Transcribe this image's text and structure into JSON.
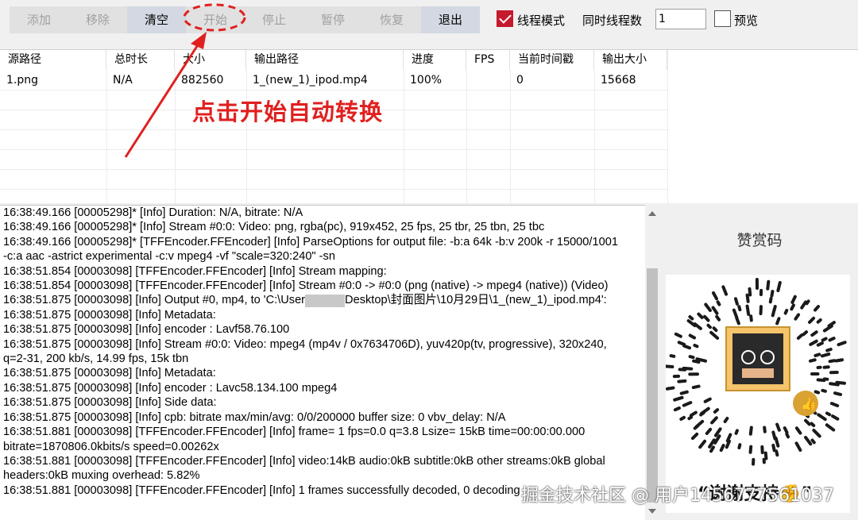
{
  "toolbar": {
    "add": "添加",
    "remove": "移除",
    "clear": "清空",
    "start": "开始",
    "stop": "停止",
    "pause": "暂停",
    "resume": "恢复",
    "exit": "退出",
    "thread_mode_label": "线程模式",
    "concurrent_label": "同时线程数",
    "concurrent_value": "1",
    "preview_label": "预览"
  },
  "table": {
    "headers": [
      "源路径",
      "总时长",
      "大小",
      "输出路径",
      "进度",
      "FPS",
      "当前时间戳",
      "输出大小"
    ],
    "rows": [
      [
        "1.png",
        "N/A",
        "882560",
        "1_(new_1)_ipod.mp4",
        "100%",
        "",
        "0",
        "15668"
      ]
    ]
  },
  "annotation": {
    "text": "点击开始自动转换"
  },
  "log": [
    "16:38:49.166 [00005298]* [Info]   Duration: N/A, bitrate: N/A",
    "16:38:49.166 [00005298]* [Info]   Stream #0:0: Video: png, rgba(pc), 919x452, 25 fps, 25 tbr, 25 tbn, 25 tbc",
    "16:38:49.166 [00005298]* [TFFEncoder.FFEncoder] [Info] ParseOptions for output file: -b:a 64k -b:v 200k -r 15000/1001",
    "-c:a aac -astrict experimental -c:v mpeg4 -vf \"scale=320:240\" -sn",
    "16:38:51.854 [00003098] [TFFEncoder.FFEncoder] [Info] Stream mapping:",
    "16:38:51.854 [00003098] [TFFEncoder.FFEncoder] [Info]   Stream #0:0 -> #0:0 (png (native) -> mpeg4 (native)) (Video)",
    "16:38:51.875 [00003098] [Info] Output #0, mp4, to 'C:\\User",
    "16:38:51.875 [00003098] [Info]   Metadata:",
    "16:38:51.875 [00003098] [Info]     encoder         : Lavf58.76.100",
    "16:38:51.875 [00003098] [Info]   Stream #0:0: Video: mpeg4 (mp4v / 0x7634706D), yuv420p(tv, progressive), 320x240,",
    "q=2-31, 200 kb/s, 14.99 fps, 15k tbn",
    "16:38:51.875 [00003098] [Info]     Metadata:",
    "16:38:51.875 [00003098] [Info]       encoder         : Lavc58.134.100 mpeg4",
    "16:38:51.875 [00003098] [Info]     Side data:",
    "16:38:51.875 [00003098] [Info]       cpb: bitrate max/min/avg: 0/0/200000 buffer size: 0 vbv_delay: N/A",
    "16:38:51.881 [00003098] [TFFEncoder.FFEncoder] [Info] frame=    1 fps=0.0 q=3.8 Lsize=       15kB time=00:00:00.000",
    "bitrate=1870806.0kbits/s speed=0.00262x",
    "16:38:51.881 [00003098] [TFFEncoder.FFEncoder] [Info] video:14kB audio:0kB subtitle:0kB other streams:0kB global",
    "headers:0kB muxing overhead: 5.82%",
    "16:38:51.881 [00003098] [TFFEncoder.FFEncoder] [Info] 1 frames successfully decoded, 0 decoding"
  ],
  "log_path_tail": "Desktop\\封面图片\\10月29日\\1_(new_1)_ipod.mp4':",
  "side": {
    "title": "赞赏码",
    "thanks": "“谢谢支持✊”"
  },
  "watermark": "掘金技术社区 @ 用户1456777561037",
  "colors": {
    "accent_red": "#e02020",
    "checkbox_red": "#c5192d",
    "enabled_button": "#d3d8e2"
  }
}
